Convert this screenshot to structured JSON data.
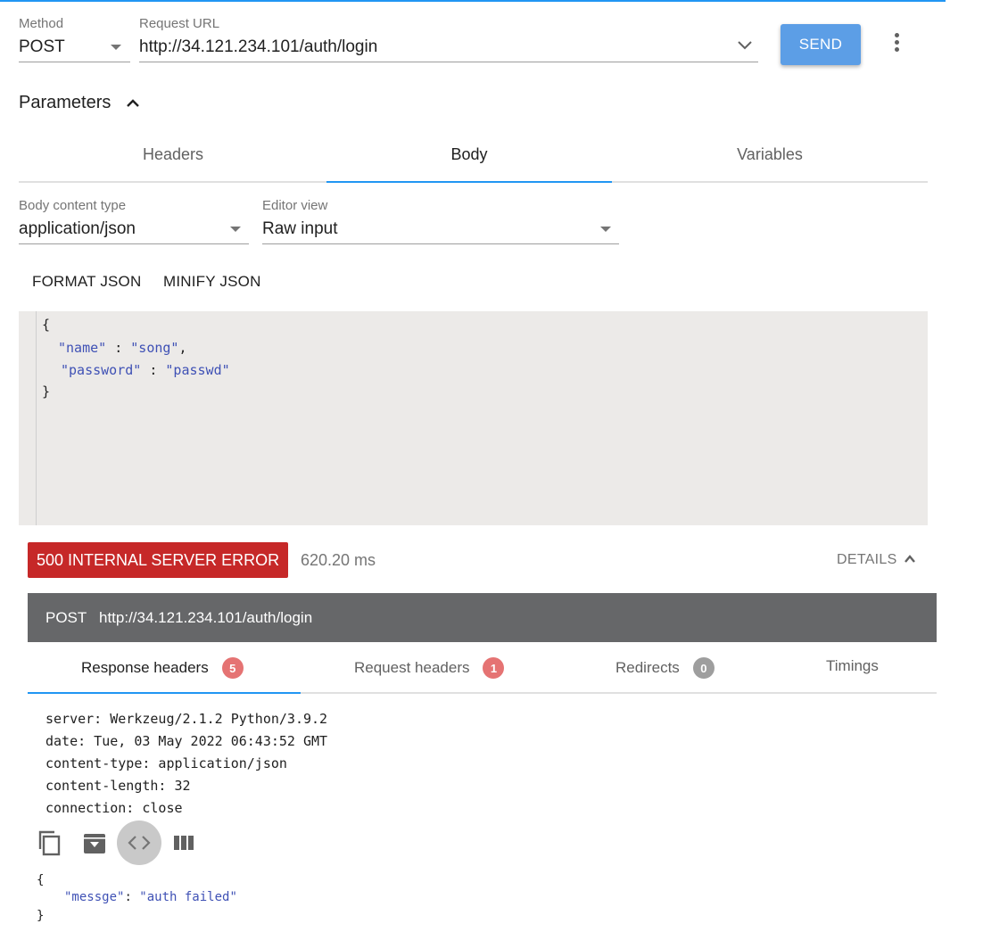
{
  "request": {
    "method_label": "Method",
    "method": "POST",
    "url_label": "Request URL",
    "url": "http://34.121.234.101/auth/login",
    "send_label": "SEND"
  },
  "parameters": {
    "title": "Parameters",
    "tabs": [
      {
        "label": "Headers",
        "active": false
      },
      {
        "label": "Body",
        "active": true
      },
      {
        "label": "Variables",
        "active": false
      }
    ],
    "body_content_type_label": "Body content type",
    "body_content_type": "application/json",
    "editor_view_label": "Editor view",
    "editor_view": "Raw input",
    "format_label": "FORMAT JSON",
    "minify_label": "MINIFY JSON",
    "body_lines": {
      "open": "{",
      "name_key": "\"name\"",
      "name_sep": " : ",
      "name_val": "\"song\"",
      "name_comma": ",",
      "pw_key": "\"password\"",
      "pw_sep": " : ",
      "pw_val": "\"passwd\"",
      "close": "}"
    }
  },
  "response": {
    "status": "500 INTERNAL SERVER ERROR",
    "time": "620.20 ms",
    "details_label": "DETAILS",
    "req_method": "POST",
    "req_url": "http://34.121.234.101/auth/login",
    "tabs": [
      {
        "label": "Response headers",
        "count": "5"
      },
      {
        "label": "Request headers",
        "count": "1"
      },
      {
        "label": "Redirects",
        "count": "0"
      },
      {
        "label": "Timings",
        "count": ""
      }
    ],
    "headers": [
      "server: Werkzeug/2.1.2 Python/3.9.2",
      "date: Tue, 03 May 2022 06:43:52 GMT",
      "content-type: application/json",
      "content-length: 32",
      "connection: close"
    ],
    "body_lines": {
      "open": "{",
      "key": "\"messge\"",
      "sep": ": ",
      "val": "\"auth failed\"",
      "close": "}"
    }
  },
  "colors": {
    "accent": "#2196f3",
    "send": "#5c9ee6",
    "error": "#c62828",
    "badge_red": "#e57373",
    "badge_grey": "#9e9e9e"
  }
}
